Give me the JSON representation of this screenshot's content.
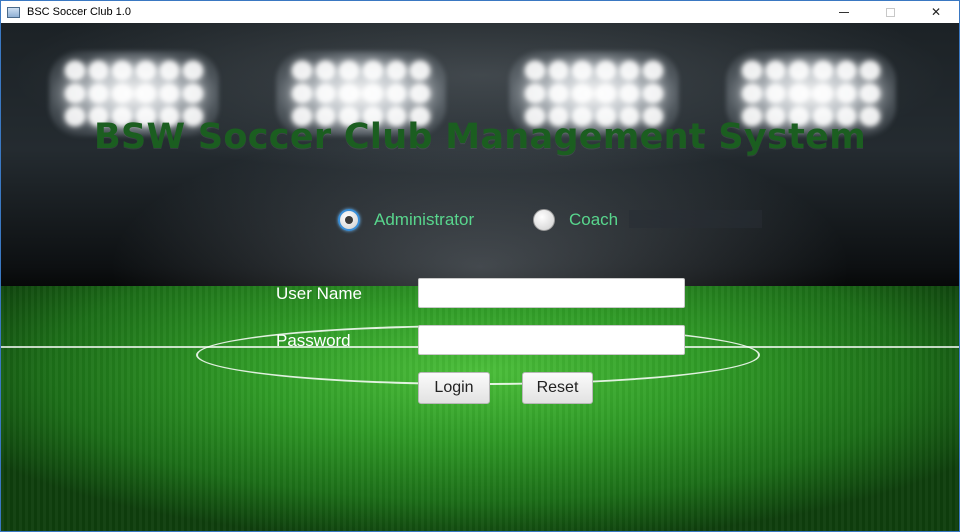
{
  "window": {
    "title": "BSC Soccer Club 1.0",
    "controls": {
      "minimize": "—",
      "maximize": "☐",
      "close": "✕"
    }
  },
  "app": {
    "heading": "BSW Soccer Club Management System"
  },
  "role_selector": {
    "options": [
      {
        "label": "Administrator",
        "selected": true
      },
      {
        "label": "Coach",
        "selected": false
      }
    ]
  },
  "login_form": {
    "username_label": "User Name",
    "username_value": "",
    "password_label": "Password",
    "password_value": "",
    "login_button": "Login",
    "reset_button": "Reset"
  },
  "colors": {
    "heading": "#1b5e20",
    "radio_label": "#58d68d",
    "field_label": "#ffffff",
    "window_border": "#3a78c2"
  }
}
